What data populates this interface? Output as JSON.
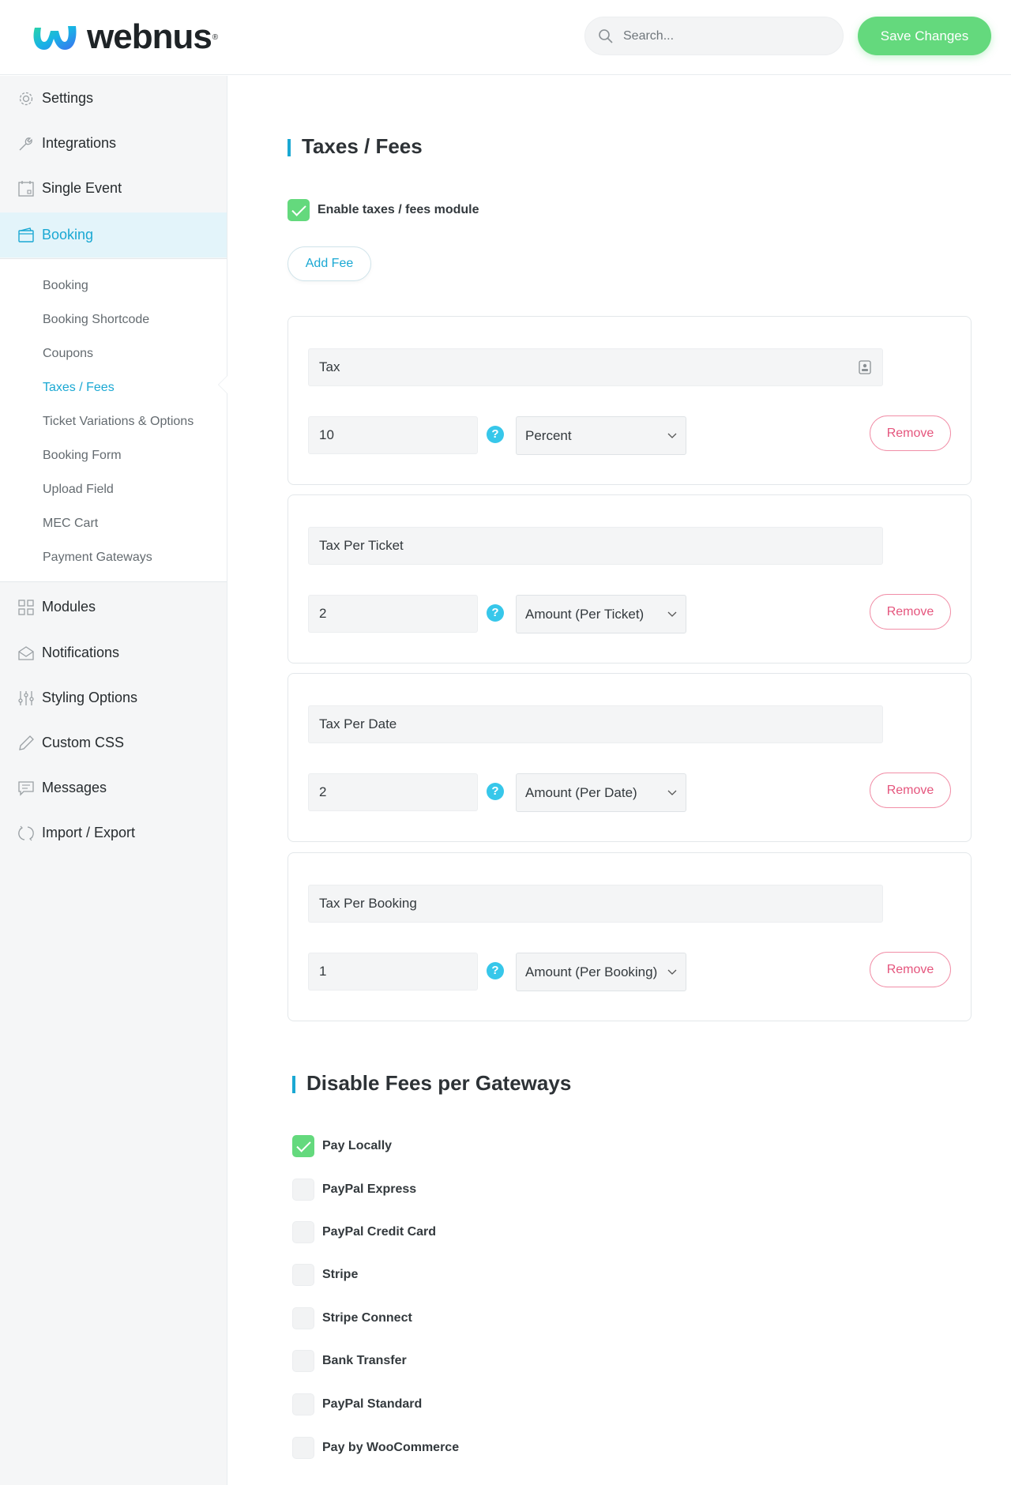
{
  "header": {
    "brand": "webnus",
    "brand_mark": "®",
    "search_placeholder": "Search...",
    "save_label": "Save Changes"
  },
  "sidebar": {
    "items": [
      {
        "label": "Settings",
        "icon": "gear-icon"
      },
      {
        "label": "Integrations",
        "icon": "wrench-icon"
      },
      {
        "label": "Single Event",
        "icon": "calendar-icon"
      },
      {
        "label": "Booking",
        "icon": "wallet-icon",
        "active": true
      },
      {
        "label": "Modules",
        "icon": "grid-icon"
      },
      {
        "label": "Notifications",
        "icon": "envelope-icon"
      },
      {
        "label": "Styling Options",
        "icon": "sliders-icon"
      },
      {
        "label": "Custom CSS",
        "icon": "pencil-icon"
      },
      {
        "label": "Messages",
        "icon": "chat-icon"
      },
      {
        "label": "Import / Export",
        "icon": "refresh-icon"
      }
    ],
    "booking_sub": [
      "Booking",
      "Booking Shortcode",
      "Coupons",
      "Taxes / Fees",
      "Ticket Variations & Options",
      "Booking Form",
      "Upload Field",
      "MEC Cart",
      "Payment Gateways"
    ],
    "active_sub": "Taxes / Fees"
  },
  "taxes": {
    "title": "Taxes / Fees",
    "enable_label": "Enable taxes / fees module",
    "enabled": true,
    "add_fee_label": "Add Fee",
    "help_glyph": "?",
    "remove_label": "Remove",
    "fees": [
      {
        "title": "Tax",
        "amount": "10",
        "type": "Percent"
      },
      {
        "title": "Tax Per Ticket",
        "amount": "2",
        "type": "Amount (Per Ticket)"
      },
      {
        "title": "Tax Per Date",
        "amount": "2",
        "type": "Amount (Per Date)"
      },
      {
        "title": "Tax Per Booking",
        "amount": "1",
        "type": "Amount (Per Booking)"
      }
    ]
  },
  "gateways": {
    "title": "Disable Fees per Gateways",
    "items": [
      {
        "label": "Pay Locally",
        "checked": true
      },
      {
        "label": "PayPal Express",
        "checked": false
      },
      {
        "label": "PayPal Credit Card",
        "checked": false
      },
      {
        "label": "Stripe",
        "checked": false
      },
      {
        "label": "Stripe Connect",
        "checked": false
      },
      {
        "label": "Bank Transfer",
        "checked": false
      },
      {
        "label": "PayPal Standard",
        "checked": false
      },
      {
        "label": "Pay by WooCommerce",
        "checked": false
      }
    ]
  },
  "colors": {
    "accent": "#1aa8d3",
    "save": "#64d97d",
    "remove": "#e5557d",
    "help": "#37c7ea"
  }
}
